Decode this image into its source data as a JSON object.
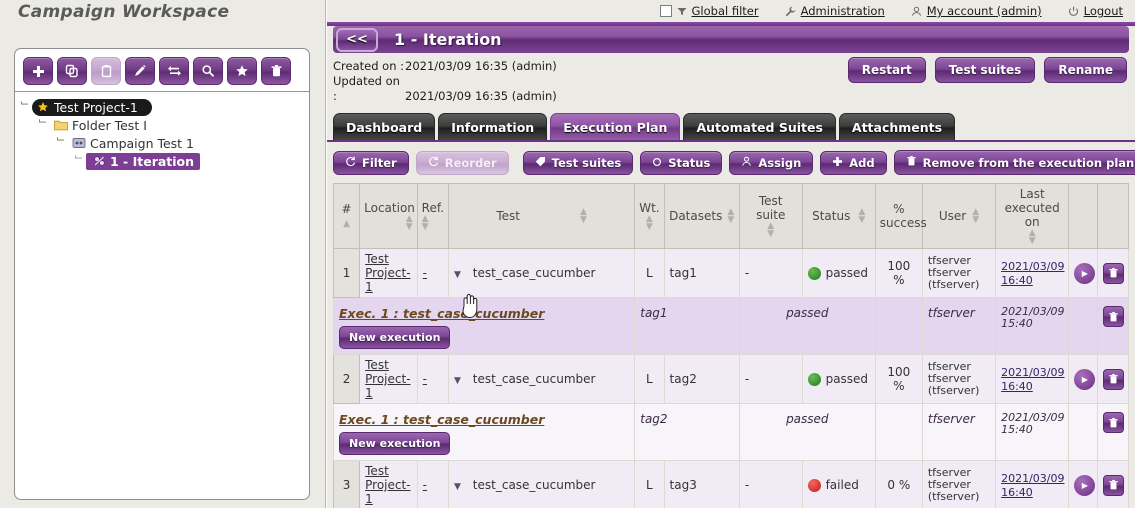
{
  "workspace": {
    "title": "Campaign Workspace"
  },
  "tree_toolbar": [
    {
      "name": "add-button",
      "icon": "plus-icon",
      "disabled": false
    },
    {
      "name": "copy-button",
      "icon": "copy-icon",
      "disabled": false
    },
    {
      "name": "paste-button",
      "icon": "paste-icon",
      "disabled": true
    },
    {
      "name": "edit-button",
      "icon": "pencil-icon",
      "disabled": false
    },
    {
      "name": "move-button",
      "icon": "move-arrows-icon",
      "disabled": false
    },
    {
      "name": "search-button",
      "icon": "search-icon",
      "disabled": false
    },
    {
      "name": "favorite-button",
      "icon": "star-icon",
      "disabled": false
    },
    {
      "name": "delete-button",
      "icon": "trash-icon",
      "disabled": false
    }
  ],
  "tree": [
    {
      "label": "Test Project-1",
      "icon": "star-icon",
      "depth": 0,
      "state": "selected-black"
    },
    {
      "label": "Folder Test I",
      "icon": "folder-icon",
      "depth": 1,
      "state": "normal"
    },
    {
      "label": "Campaign Test 1",
      "icon": "campaign-icon",
      "depth": 2,
      "state": "normal"
    },
    {
      "label": "1 - Iteration",
      "icon": "iteration-icon",
      "depth": 3,
      "state": "selected-purple"
    }
  ],
  "topnav": {
    "global_filter": "Global filter",
    "administration": "Administration",
    "my_account": "My account (admin)",
    "logout": "Logout"
  },
  "header": {
    "back_label": "<<",
    "page_title": "1 - Iteration",
    "created_label": "Created on :",
    "created_value": "2021/03/09 16:35 (admin)",
    "updated_label": "Updated on :",
    "updated_value": "2021/03/09 16:35 (admin)",
    "actions": [
      {
        "label": "Restart",
        "name": "restart-button"
      },
      {
        "label": "Test suites",
        "name": "test-suites-button"
      },
      {
        "label": "Rename",
        "name": "rename-button"
      }
    ]
  },
  "tabs": [
    {
      "label": "Dashboard",
      "active": false
    },
    {
      "label": "Information",
      "active": false
    },
    {
      "label": "Execution Plan",
      "active": true
    },
    {
      "label": "Automated Suites",
      "active": false
    },
    {
      "label": "Attachments",
      "active": false
    }
  ],
  "toolbar": [
    {
      "label": "Filter",
      "icon": "refresh-icon",
      "name": "filter-button",
      "disabled": false
    },
    {
      "label": "Reorder",
      "icon": "refresh-icon",
      "name": "reorder-button",
      "disabled": true
    },
    {
      "label": "Test suites",
      "icon": "tag-icon",
      "name": "test-suites-toolbar-button",
      "disabled": false
    },
    {
      "label": "Status",
      "icon": "circle-icon",
      "name": "status-button",
      "disabled": false
    },
    {
      "label": "Assign",
      "icon": "user-icon",
      "name": "assign-button",
      "disabled": false
    },
    {
      "label": "Add",
      "icon": "plus-icon",
      "name": "add-button",
      "disabled": false
    },
    {
      "label": "Remove from the execution plan",
      "icon": "trash-icon",
      "name": "remove-button",
      "disabled": false
    }
  ],
  "table": {
    "columns": [
      {
        "label": "#",
        "sort": "asc"
      },
      {
        "label": "Location",
        "sort": "both"
      },
      {
        "label": "Ref.",
        "sort": "both"
      },
      {
        "label": "Test",
        "sort": "both"
      },
      {
        "label": "Wt.",
        "sort": "both"
      },
      {
        "label": "Datasets",
        "sort": "both"
      },
      {
        "label": "Test suite",
        "sort": "both"
      },
      {
        "label": "Status",
        "sort": "both"
      },
      {
        "label": "% success",
        "sort": "none"
      },
      {
        "label": "User",
        "sort": "both"
      },
      {
        "label": "Last executed on",
        "sort": "both"
      },
      {
        "label": "",
        "sort": "none"
      },
      {
        "label": "",
        "sort": "none"
      }
    ],
    "rows": [
      {
        "type": "test",
        "num": "1",
        "location": "Test Project-1",
        "ref": "-",
        "test": "test_case_cucumber",
        "wt": "L",
        "datasets": "tag1",
        "test_suite": "-",
        "status": "passed",
        "status_color": "green",
        "success": "100 %",
        "user": "tfserver tfserver (tfserver)",
        "last_executed": "2021/03/09 16:40",
        "has_play": true,
        "has_delete": true
      },
      {
        "type": "exec",
        "exec_prefix": "Exec. 1 :",
        "exec_name": "test_case_cucumber",
        "datasets": "tag1",
        "status": "passed",
        "user": "tfserver",
        "last_executed": "2021/03/09 15:40",
        "new_execution_label": "New execution",
        "has_delete": true,
        "highlight": true
      },
      {
        "type": "test",
        "num": "2",
        "location": "Test Project-1",
        "ref": "-",
        "test": "test_case_cucumber",
        "wt": "L",
        "datasets": "tag2",
        "test_suite": "-",
        "status": "passed",
        "status_color": "green",
        "success": "100 %",
        "user": "tfserver tfserver (tfserver)",
        "last_executed": "2021/03/09 16:40",
        "has_play": true,
        "has_delete": true
      },
      {
        "type": "exec",
        "exec_prefix": "Exec. 1 :",
        "exec_name": "test_case_cucumber",
        "datasets": "tag2",
        "status": "passed",
        "user": "tfserver",
        "last_executed": "2021/03/09 15:40",
        "new_execution_label": "New execution",
        "has_delete": true,
        "highlight": false
      },
      {
        "type": "test",
        "num": "3",
        "location": "Test Project-1",
        "ref": "-",
        "test": "test_case_cucumber",
        "wt": "L",
        "datasets": "tag3",
        "test_suite": "-",
        "status": "failed",
        "status_color": "red",
        "success": "0 %",
        "user": "tfserver tfserver (tfserver)",
        "last_executed": "2021/03/09 16:40",
        "has_play": true,
        "has_delete": true
      }
    ]
  },
  "colors": {
    "accent": "#7c3f94",
    "accent_dark": "#5c2a72",
    "page_bg": "#eceae4",
    "row_bg": "#f1ebf6",
    "exec_row_bg": "#e3d6ee",
    "status_passed": "#2e8b20",
    "status_failed": "#d02020"
  }
}
